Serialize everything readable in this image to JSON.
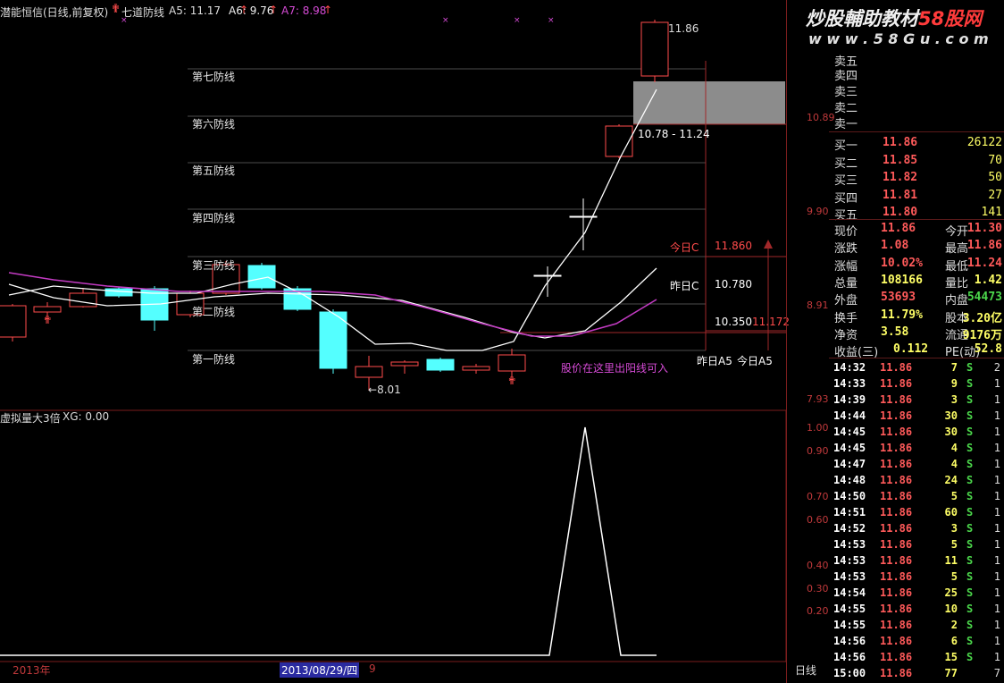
{
  "header": {
    "stock_name": "潜能恒信(日线,前复权)",
    "indicator": "七道防线",
    "a5": "A5: 11.17",
    "a6": "A6: 9.76",
    "a7": "A7: 8.98"
  },
  "watermark": {
    "line1": "炒股輔助教材",
    "line1b": "58股网",
    "line2": "w w w . 5 8 G u . c o m"
  },
  "defense_lines": [
    "第七防线",
    "第六防线",
    "第五防线",
    "第四防线",
    "第三防线",
    "第二防线",
    "第一防线"
  ],
  "price_axis": [
    "10.89",
    "9.90",
    "8.91",
    "7.93"
  ],
  "annotations": {
    "high": "11.86",
    "low": "8.01",
    "range": "10.78 - 11.24",
    "today_c_label": "今日C",
    "today_c_val": "11.860",
    "yest_c_label": "昨日C",
    "yest_c_val": "10.780",
    "val_10350": "10.350",
    "val_11172": "11.172",
    "yest_a5": "昨日A5",
    "today_a5": "今日A5",
    "buy_note": "股价在这里出阳线可入"
  },
  "sub_indicator": {
    "title": "虚拟量大3倍",
    "xg": "XG: 0.00",
    "axis": [
      "1.00",
      "0.90",
      "0.70",
      "0.60",
      "0.40",
      "0.30",
      "0.20"
    ]
  },
  "bottom": {
    "year": "2013年",
    "date": "2013/08/29/四",
    "nine": "9",
    "period": "日线"
  },
  "order_book": {
    "sells": [
      "卖五",
      "卖四",
      "卖三",
      "卖二",
      "卖一"
    ],
    "buys": [
      {
        "label": "买一",
        "price": "11.86",
        "vol": "26122"
      },
      {
        "label": "买二",
        "price": "11.85",
        "vol": "70"
      },
      {
        "label": "买三",
        "price": "11.82",
        "vol": "50"
      },
      {
        "label": "买四",
        "price": "11.81",
        "vol": "27"
      },
      {
        "label": "买五",
        "price": "11.80",
        "vol": "141"
      }
    ]
  },
  "quote": {
    "r1": {
      "a": "现价",
      "av": "11.86",
      "b": "今开",
      "bv": "11.30"
    },
    "r2": {
      "a": "涨跌",
      "av": "1.08",
      "b": "最高",
      "bv": "11.86"
    },
    "r3": {
      "a": "涨幅",
      "av": "10.02%",
      "b": "最低",
      "bv": "11.24"
    },
    "r4": {
      "a": "总量",
      "av": "108166",
      "b": "量比",
      "bv": "1.42"
    },
    "r5": {
      "a": "外盘",
      "av": "53693",
      "b": "内盘",
      "bv": "54473"
    },
    "r6": {
      "a": "换手",
      "av": "11.79%",
      "b": "股本",
      "bv": "3.20亿"
    },
    "r7": {
      "a": "净资",
      "av": "3.58",
      "b": "流通",
      "bv": "9176万"
    },
    "r8": {
      "a": "收益(三)",
      "av": "0.112",
      "b": "PE(动)",
      "bv": "52.8"
    }
  },
  "ticks": [
    {
      "time": "14:32",
      "price": "11.86",
      "vol": "7",
      "bs": "S",
      "n": "2"
    },
    {
      "time": "14:33",
      "price": "11.86",
      "vol": "9",
      "bs": "S",
      "n": "1"
    },
    {
      "time": "14:39",
      "price": "11.86",
      "vol": "3",
      "bs": "S",
      "n": "1"
    },
    {
      "time": "14:44",
      "price": "11.86",
      "vol": "30",
      "bs": "S",
      "n": "1"
    },
    {
      "time": "14:45",
      "price": "11.86",
      "vol": "30",
      "bs": "S",
      "n": "1"
    },
    {
      "time": "14:45",
      "price": "11.86",
      "vol": "4",
      "bs": "S",
      "n": "1"
    },
    {
      "time": "14:47",
      "price": "11.86",
      "vol": "4",
      "bs": "S",
      "n": "1"
    },
    {
      "time": "14:48",
      "price": "11.86",
      "vol": "24",
      "bs": "S",
      "n": "1"
    },
    {
      "time": "14:50",
      "price": "11.86",
      "vol": "5",
      "bs": "S",
      "n": "1"
    },
    {
      "time": "14:51",
      "price": "11.86",
      "vol": "60",
      "bs": "S",
      "n": "1"
    },
    {
      "time": "14:52",
      "price": "11.86",
      "vol": "3",
      "bs": "S",
      "n": "1"
    },
    {
      "time": "14:53",
      "price": "11.86",
      "vol": "5",
      "bs": "S",
      "n": "1"
    },
    {
      "time": "14:53",
      "price": "11.86",
      "vol": "11",
      "bs": "S",
      "n": "1"
    },
    {
      "time": "14:53",
      "price": "11.86",
      "vol": "5",
      "bs": "S",
      "n": "1"
    },
    {
      "time": "14:54",
      "price": "11.86",
      "vol": "25",
      "bs": "S",
      "n": "1"
    },
    {
      "time": "14:55",
      "price": "11.86",
      "vol": "10",
      "bs": "S",
      "n": "1"
    },
    {
      "time": "14:55",
      "price": "11.86",
      "vol": "2",
      "bs": "S",
      "n": "1"
    },
    {
      "time": "14:56",
      "price": "11.86",
      "vol": "6",
      "bs": "S",
      "n": "1"
    },
    {
      "time": "14:56",
      "price": "11.86",
      "vol": "15",
      "bs": "S",
      "n": "1"
    },
    {
      "time": "15:00",
      "price": "11.86",
      "vol": "77",
      "bs": "",
      "n": "7"
    }
  ],
  "colors": {
    "up": "#ff4b4b",
    "down": "#54ffff",
    "ma_white": "#ffffff",
    "ma_magenta": "#c33bc3",
    "grid": "#7a1d1d"
  }
}
